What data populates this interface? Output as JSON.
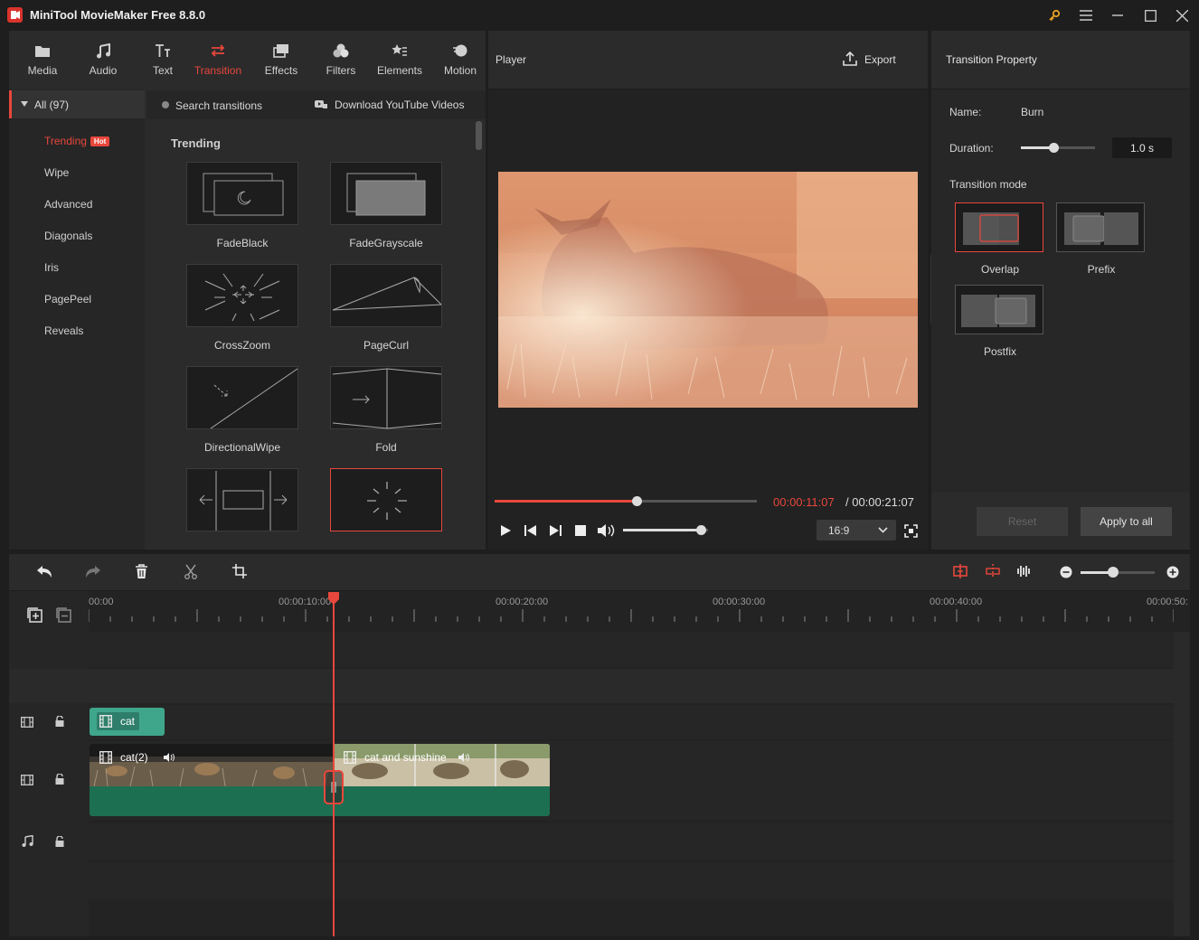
{
  "app": {
    "title": "MiniTool MovieMaker Free 8.8.0"
  },
  "toolbar": {
    "tabs": [
      {
        "label": "Media",
        "icon": "folder-icon"
      },
      {
        "label": "Audio",
        "icon": "music-note-icon"
      },
      {
        "label": "Text",
        "icon": "text-icon"
      },
      {
        "label": "Transition",
        "icon": "transition-icon"
      },
      {
        "label": "Effects",
        "icon": "effects-icon"
      },
      {
        "label": "Filters",
        "icon": "filters-icon"
      },
      {
        "label": "Elements",
        "icon": "elements-icon"
      },
      {
        "label": "Motion",
        "icon": "motion-icon"
      }
    ],
    "active": "Transition",
    "accent": "#e8473c"
  },
  "categories": {
    "all_label": "All (97)",
    "items": [
      {
        "label": "Trending",
        "badge": "Hot"
      },
      {
        "label": "Wipe"
      },
      {
        "label": "Advanced"
      },
      {
        "label": "Diagonals"
      },
      {
        "label": "Iris"
      },
      {
        "label": "PagePeel"
      },
      {
        "label": "Reveals"
      }
    ]
  },
  "search": {
    "placeholder": "Search transitions",
    "download_label": "Download YouTube Videos"
  },
  "transitions": {
    "section_title": "Trending",
    "items": [
      "FadeBlack",
      "FadeGrayscale",
      "CrossZoom",
      "PageCurl",
      "DirectionalWipe",
      "Fold"
    ]
  },
  "player": {
    "title": "Player",
    "export_label": "Export",
    "current_time": "00:00:11:07",
    "total_time": "/ 00:00:21:07",
    "progress": 0.54,
    "volume": 0.91,
    "aspect_ratio": "16:9"
  },
  "property": {
    "title": "Transition Property",
    "name_label": "Name:",
    "name_value": "Burn",
    "duration_label": "Duration:",
    "duration_value": "1.0 s",
    "mode_label": "Transition mode",
    "modes": [
      "Overlap",
      "Prefix",
      "Postfix"
    ],
    "selected_mode": "Overlap",
    "reset_label": "Reset",
    "apply_label": "Apply to all"
  },
  "timeline": {
    "ruler": [
      "00:00",
      "00:00:10:00",
      "00:00:20:00",
      "00:00:30:00",
      "00:00:40:00",
      "00:00:50:"
    ],
    "clips": {
      "overlay_clip": "cat",
      "video_clip_1": "cat(2)",
      "video_clip_2": "cat and sunshine"
    }
  }
}
